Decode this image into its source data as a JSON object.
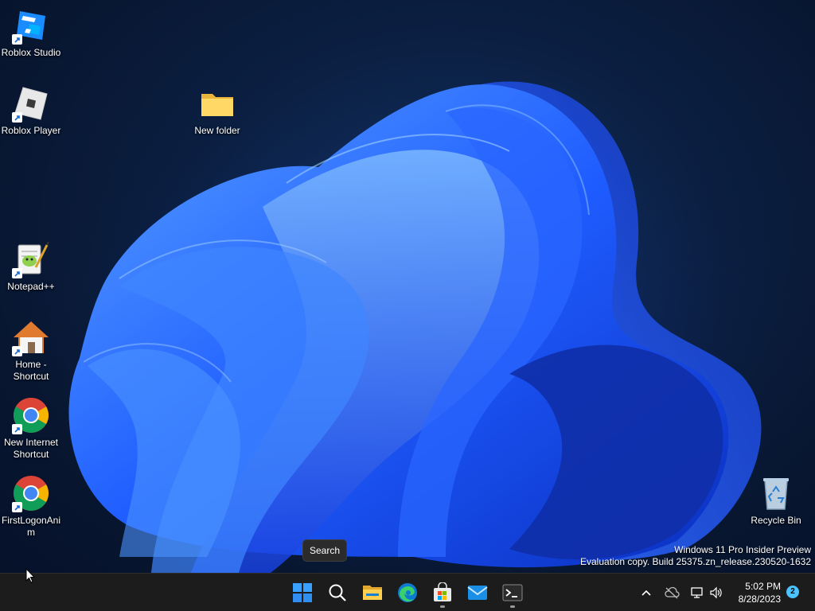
{
  "desktop_icons": [
    {
      "label": "Roblox Studio",
      "icon": "roblox-studio-icon"
    },
    {
      "label": "Roblox Player",
      "icon": "roblox-player-icon"
    },
    {
      "label": "New folder",
      "icon": "folder-icon"
    },
    {
      "label": "Notepad++",
      "icon": "notepad-plus-plus-icon"
    },
    {
      "label": "Home -\nShortcut",
      "icon": "home-icon"
    },
    {
      "label": "New Internet\nShortcut",
      "icon": "chrome-icon"
    },
    {
      "label": "FirstLogonAni\nm",
      "icon": "chrome-icon"
    },
    {
      "label": "Recycle Bin",
      "icon": "recycle-bin-icon"
    }
  ],
  "tooltip": {
    "search": "Search"
  },
  "watermark": {
    "line1": "Windows 11 Pro Insider Preview",
    "line2": "Evaluation copy. Build 25375.zn_release.230520-1632"
  },
  "taskbar": {
    "apps": [
      {
        "name": "Start",
        "icon": "windows-start-icon"
      },
      {
        "name": "Search",
        "icon": "search-icon"
      },
      {
        "name": "File Explorer",
        "icon": "file-explorer-icon"
      },
      {
        "name": "Microsoft Edge",
        "icon": "edge-icon"
      },
      {
        "name": "Microsoft Store",
        "icon": "store-icon",
        "running": true
      },
      {
        "name": "Mail",
        "icon": "mail-icon"
      },
      {
        "name": "Terminal",
        "icon": "terminal-icon",
        "running": true
      }
    ],
    "tray": {
      "icons": [
        "chevron-up-icon",
        "cloud-offline-icon",
        "network-icon",
        "volume-icon"
      ],
      "time": "5:02 PM",
      "date": "8/28/2023",
      "notification_count": "2"
    }
  },
  "colors": {
    "taskbar_bg": "#1c1c1c",
    "accent": "#4cc2ff",
    "wallpaper_blue": "#1e5bff"
  }
}
